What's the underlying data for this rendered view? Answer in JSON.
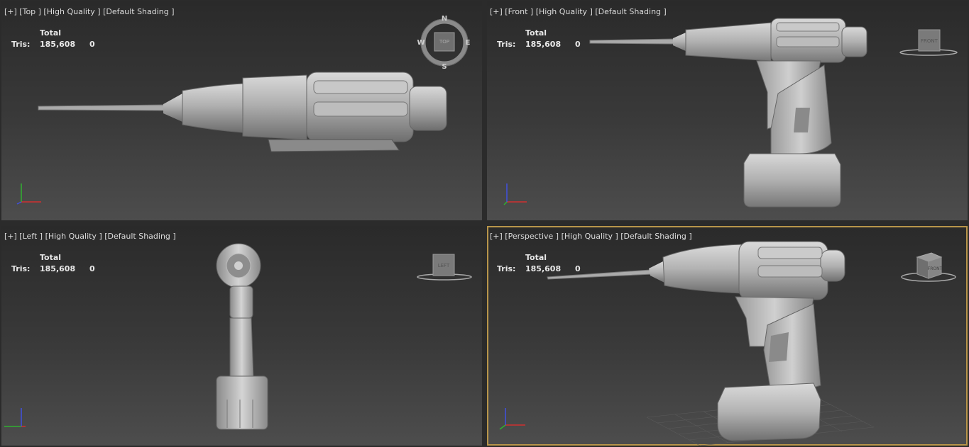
{
  "viewports": [
    {
      "id": "top",
      "label": "[+] [Top ] [High Quality ] [Default Shading ]",
      "stats": {
        "header": "Total",
        "tris_label": "Tris:",
        "tris_total": "185,608",
        "tris_sel": "0"
      },
      "nav": "compass",
      "nav_text": "TOP",
      "compass": {
        "n": "N",
        "e": "E",
        "s": "S",
        "w": "W"
      }
    },
    {
      "id": "front",
      "label": "[+] [Front ] [High Quality ] [Default Shading ]",
      "stats": {
        "header": "Total",
        "tris_label": "Tris:",
        "tris_total": "185,608",
        "tris_sel": "0"
      },
      "nav": "cube",
      "nav_text": "FRONT"
    },
    {
      "id": "left",
      "label": "[+] [Left ] [High Quality ] [Default Shading ]",
      "stats": {
        "header": "Total",
        "tris_label": "Tris:",
        "tris_total": "185,608",
        "tris_sel": "0"
      },
      "nav": "cube",
      "nav_text": "LEFT"
    },
    {
      "id": "perspective",
      "label": "[+] [Perspective ] [High Quality ] [Default Shading ]",
      "stats": {
        "header": "Total",
        "tris_label": "Tris:",
        "tris_total": "185,608",
        "tris_sel": "0"
      },
      "nav": "cube",
      "nav_text": "FRONT",
      "active": true
    }
  ],
  "colors": {
    "active_border": "#b8954a",
    "axis_x": "#d03030",
    "axis_y": "#30b030",
    "axis_z": "#4050e0",
    "model": "#b9b9b9"
  },
  "icons": [
    "compass-icon",
    "viewcube-icon",
    "axis-tripod-icon"
  ]
}
